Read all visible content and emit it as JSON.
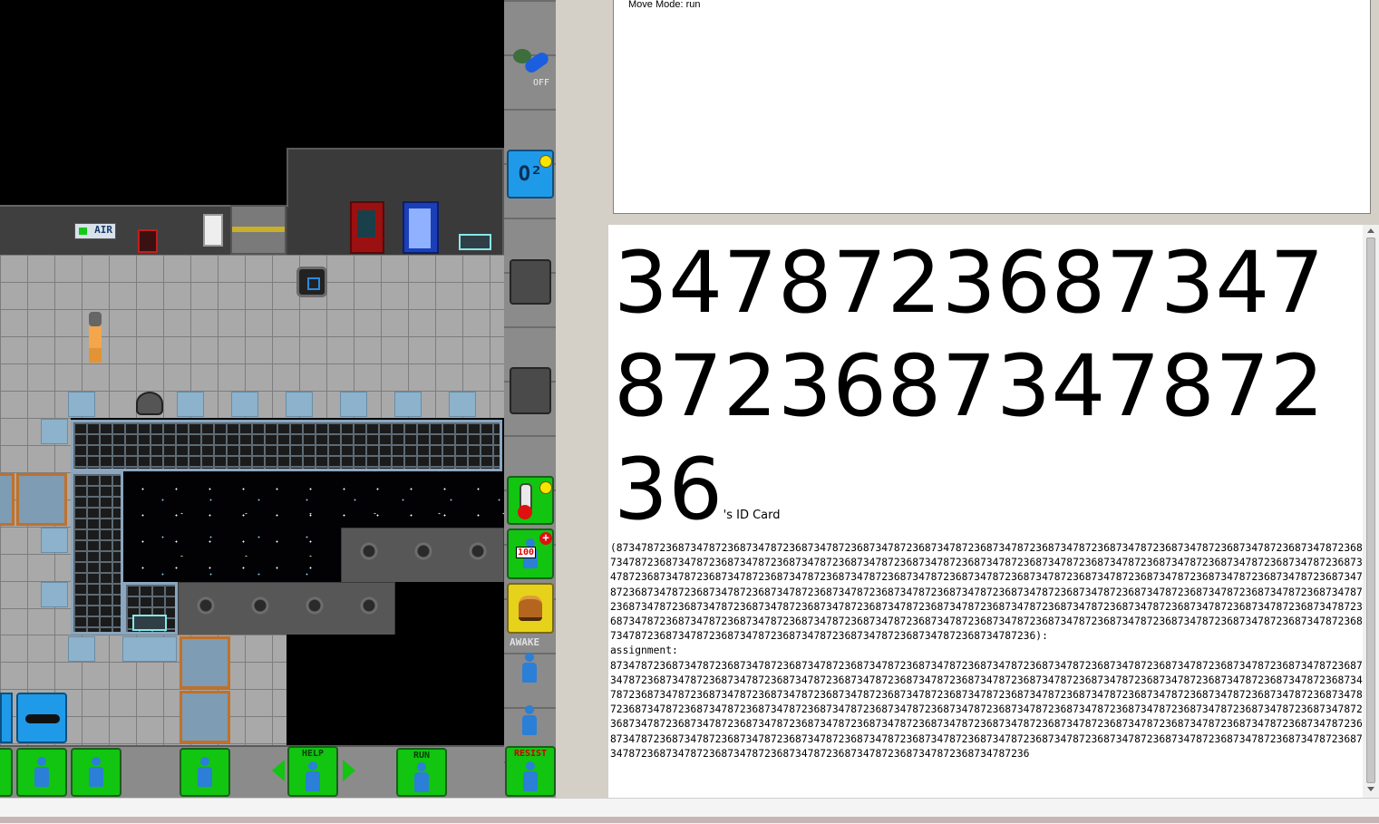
{
  "status": {
    "move_mode": "Move Mode: run"
  },
  "examine": {
    "name_big": "3478723687347872368734787236",
    "name_suffix": "'s ID Card",
    "details": "(87347872368734787236873478723687347872368734787236873478723687347872368734787236873478723687347872368734787236873478723687347872368734787236873478723687347872368734787236873478723687347872368734787236873478723687347872368734787236873478723687347872368734787236873478723687347872368734787236873478723687347872368734787236873478723687347872368734787236873478723687347872368734787236873478723687347872368734787236873478723687347872368734787236873478723687347872368734787236873478723687347872368734787236873478723687347872368734787236873478723687347872368734787236873478723687347872368734787236873478723687347872368734787236873478723687347872368734787236873478723687347872368734787236873478723687347872368734787236873478723687347872368734787236873478723687347872368734787236873478723687347872368734787236):",
    "assignment_label": "assignment:",
    "assignment_value": "87347872368734787236873478723687347872368734787236873478723687347872368734787236873478723687347872368734787236873478723687347872368734787236873478723687347872368734787236873478723687347872368734787236873478723687347872368734787236873478723687347872368734787236873478723687347872368734787236873478723687347872368734787236873478723687347872368734787236873478723687347872368734787236873478723687347872368734787236873478723687347872368734787236873478723687347872368734787236873478723687347872368734787236873478723687347872368734787236873478723687347872368734787236873478723687347872368734787236873478723687347872368734787236873478723687347872368734787236873478723687347872368734787236873478723687347872368734787236873478723687347872368734787236873478723687347872368734787236873478723687347872368734787236"
  },
  "hud": {
    "internals_label": "OFF",
    "oxygen_label": "O²",
    "health_value": "100",
    "sleep_label": "AWAKE",
    "help_label": "HELP",
    "run_label": "RUN",
    "resist_label": "RESIST",
    "air_alarm_label": "AIR",
    "tank_label": "O2"
  },
  "colors": {
    "hud_green": "#11c511",
    "hud_blue": "#1f9ae8",
    "hud_yellow": "#e6d21a"
  }
}
